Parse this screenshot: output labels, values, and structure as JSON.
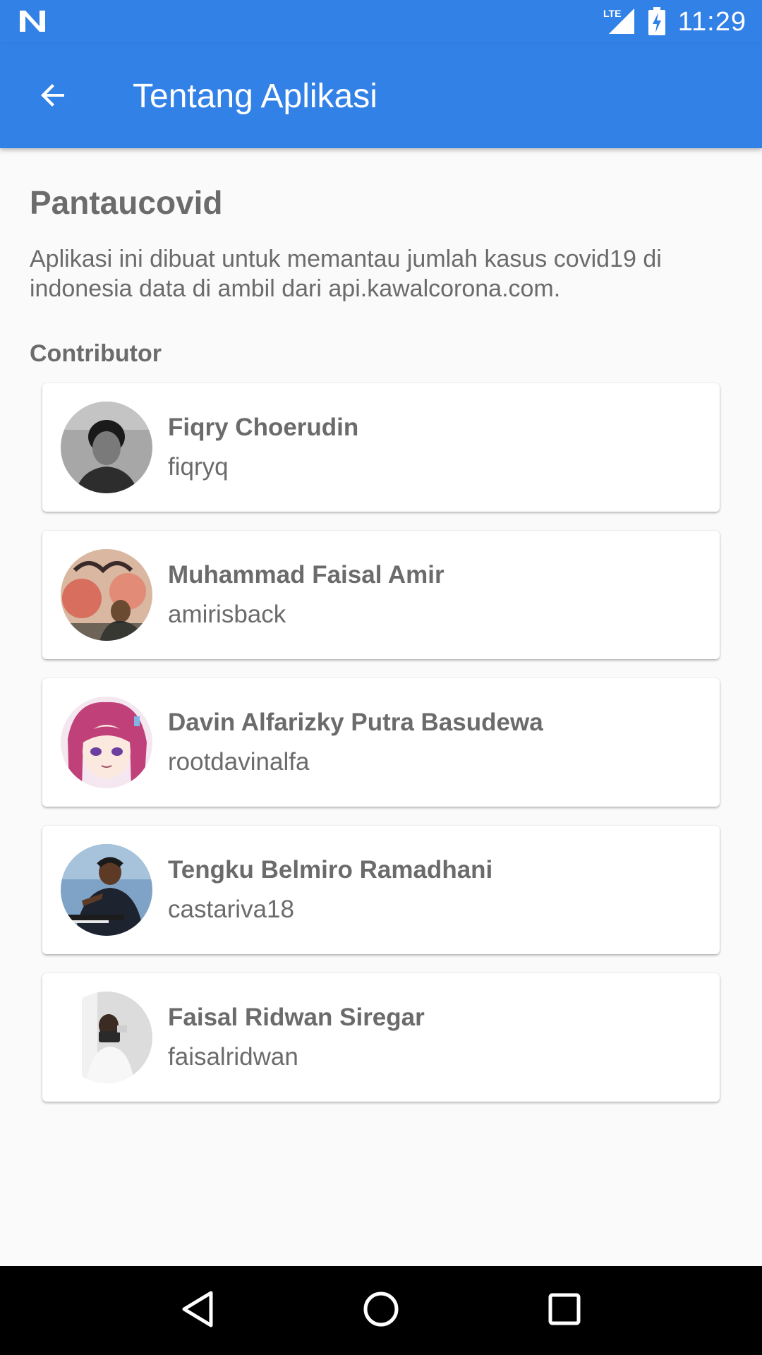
{
  "status_bar": {
    "time": "11:29",
    "network_label": "LTE",
    "icons": [
      "n-logo-icon",
      "signal-icon",
      "battery-charging-icon"
    ]
  },
  "app_bar": {
    "title": "Tentang Aplikasi",
    "back_icon": "arrow-back-icon",
    "color": "#3281e6"
  },
  "about": {
    "app_name": "Pantaucovid",
    "description": "Aplikasi ini dibuat untuk memantau jumlah kasus covid19 di indonesia data di ambil dari api.kawalcorona.com."
  },
  "contributors": {
    "title": "Contributor",
    "items": [
      {
        "name": "Fiqry Choerudin",
        "username": "fiqryq",
        "avatar": "avatar-photo-1"
      },
      {
        "name": "Muhammad Faisal Amir",
        "username": "amirisback",
        "avatar": "avatar-photo-2"
      },
      {
        "name": "Davin Alfarizky Putra Basudewa",
        "username": "rootdavinalfa",
        "avatar": "avatar-photo-3"
      },
      {
        "name": "Tengku Belmiro Ramadhani",
        "username": "castariva18",
        "avatar": "avatar-photo-4"
      },
      {
        "name": "Faisal Ridwan Siregar",
        "username": "faisalridwan",
        "avatar": "avatar-photo-5"
      }
    ]
  },
  "nav_bar": {
    "buttons": [
      "back-triangle-icon",
      "home-circle-icon",
      "recents-square-icon"
    ]
  }
}
